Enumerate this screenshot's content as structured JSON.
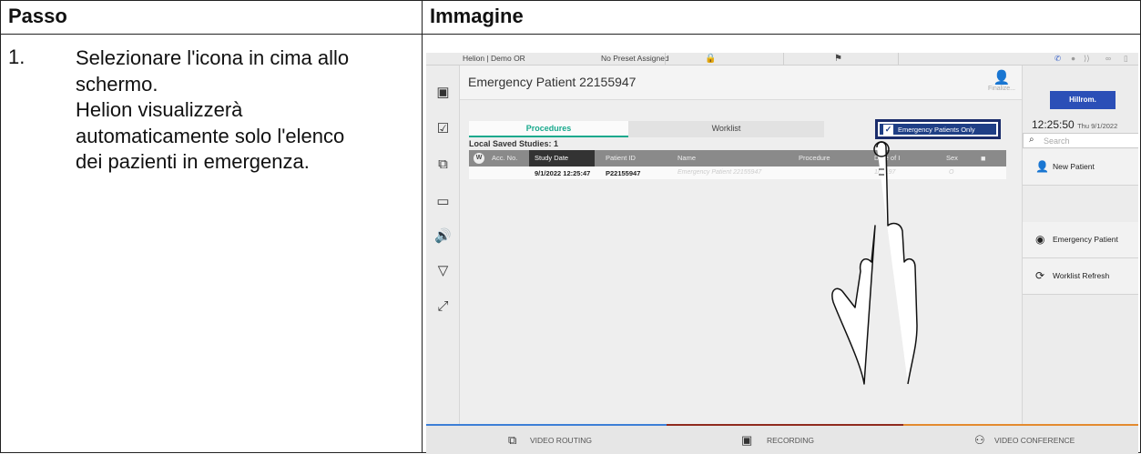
{
  "table": {
    "col1_header": "Passo",
    "col2_header": "Immagine",
    "step_number": "1.",
    "step_lines": [
      "Selezionare l'icona in cima allo",
      "schermo.",
      "Helion visualizzerà",
      "automaticamente solo l'elenco",
      "dei pazienti in emergenza."
    ]
  },
  "screen": {
    "topbar": {
      "app": "Helion | Demo OR",
      "preset": "No Preset Assigned"
    },
    "patient_title": "Emergency Patient 22155947",
    "finalize_label": "Finalize...",
    "tabs": [
      "Procedures",
      "Worklist"
    ],
    "emergency_toggle": "Emergency Patients Only",
    "local_saved": "Local Saved Studies: 1",
    "columns": {
      "w": "W",
      "acc": "Acc. No.",
      "study_date": "Study Date",
      "patient_id": "Patient ID",
      "name": "Name",
      "procedure": "Procedure",
      "dob": "Date of I",
      "sex": "Sex"
    },
    "row": {
      "study_date": "9/1/2022 12:25:47",
      "patient_id": "P22155947",
      "name": "Emergency Patient 22155947",
      "dob": "1/1/197",
      "sex": "O"
    },
    "brand": "Hillrom.",
    "clock_time": "12:25:50",
    "clock_date": "Thu 9/1/2022",
    "search_placeholder": "Search",
    "right_buttons": [
      "New Patient",
      "Emergency Patient",
      "Worklist Refresh"
    ],
    "bottom": [
      "VIDEO ROUTING",
      "RECORDING",
      "VIDEO CONFERENCE"
    ]
  }
}
